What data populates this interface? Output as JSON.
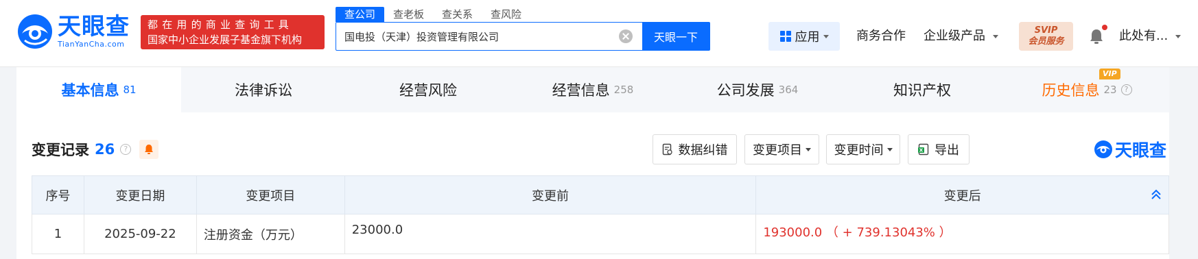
{
  "brand": {
    "name_cn": "天眼查",
    "name_en": "TianYanCha.com",
    "slogan_line1": "都在用的商业查询工具",
    "slogan_line2": "国家中小企业发展子基金旗下机构"
  },
  "search": {
    "tabs": [
      "查公司",
      "查老板",
      "查关系",
      "查风险"
    ],
    "value": "国电投（天津）投资管理有限公司",
    "button": "天眼一下"
  },
  "nav": {
    "app": "应用",
    "business": "商务合作",
    "enterprise": "企业级产品",
    "vip_top": "SVIP",
    "vip_bottom": "会员服务",
    "user": "此处有..."
  },
  "tabs": [
    {
      "label": "基本信息",
      "count": "81"
    },
    {
      "label": "法律诉讼",
      "count": ""
    },
    {
      "label": "经营风险",
      "count": ""
    },
    {
      "label": "经营信息",
      "count": "258"
    },
    {
      "label": "公司发展",
      "count": "364"
    },
    {
      "label": "知识产权",
      "count": ""
    },
    {
      "label": "历史信息",
      "count": "23",
      "tag": "VIP"
    }
  ],
  "section": {
    "title": "变更记录",
    "count": "26",
    "help": "?"
  },
  "tools": {
    "correction": "数据纠错",
    "item": "变更项目",
    "time": "变更时间",
    "export": "导出"
  },
  "table": {
    "headers": [
      "序号",
      "变更日期",
      "变更项目",
      "变更前",
      "变更后"
    ],
    "rows": [
      {
        "idx": "1",
        "date": "2025-09-22",
        "item": "注册资金（万元）",
        "before": "23000.0",
        "after": "193000.0 （ + 739.13043% ）"
      }
    ]
  },
  "colors": {
    "primary": "#0a6cff",
    "red": "#e0322d",
    "orange": "#ff6a00"
  }
}
